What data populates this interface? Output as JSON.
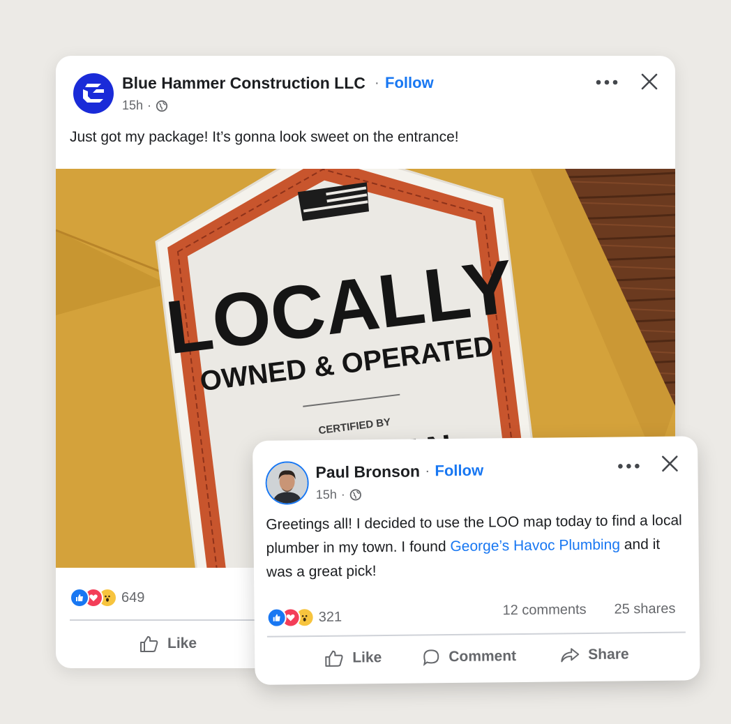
{
  "post1": {
    "author": "Blue Hammer Construction LLC",
    "separator": "·",
    "follow_label": "Follow",
    "time": "15h",
    "meta_separator": "·",
    "audience_icon": "globe-icon",
    "text": "Just got my package! It’s gonna look sweet on the entrance!",
    "image": {
      "headline": "LOCALLY",
      "subheadline": "OWNED & OPERATED",
      "certified_label": "CERTIFIED BY",
      "org": "AMERICAN"
    },
    "reaction_count": "649",
    "like_label": "Like"
  },
  "post2": {
    "author": "Paul Bronson",
    "separator": "·",
    "follow_label": "Follow",
    "time": "15h",
    "meta_separator": "·",
    "audience_icon": "globe-icon",
    "text_part1": "Greetings all! I decided to use the LOO map today to find a local plumber in my town. I found ",
    "text_link": "George’s Havoc Plumbing",
    "text_part2": " and it was a great pick!",
    "reaction_count": "321",
    "comments": "12 comments",
    "shares": "25 shares",
    "like_label": "Like",
    "comment_label": "Comment",
    "share_label": "Share"
  },
  "colors": {
    "brand_blue": "#1877f2",
    "logo_blue": "#1a2bd8",
    "badge_orange": "#c8552d",
    "envelope_gold": "#d6a43c",
    "wood": "#6b3a1f"
  }
}
